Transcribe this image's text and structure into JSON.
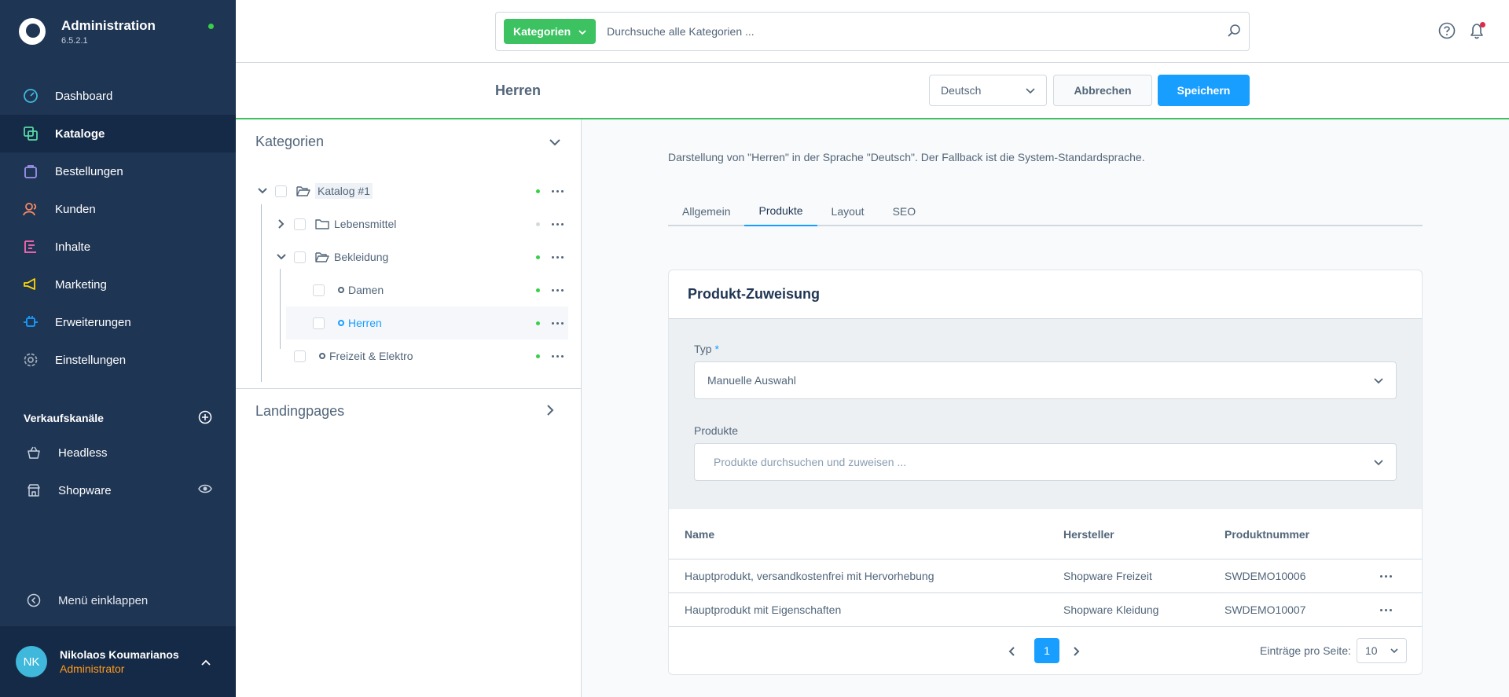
{
  "app": {
    "title": "Administration",
    "version": "6.5.2.1"
  },
  "nav": [
    {
      "label": "Dashboard",
      "icon": "dashboard-icon",
      "color": "#3fb8dc"
    },
    {
      "label": "Kataloge",
      "icon": "catalog-icon",
      "color": "#57d9a3"
    },
    {
      "label": "Bestellungen",
      "icon": "orders-icon",
      "color": "#a092f0"
    },
    {
      "label": "Kunden",
      "icon": "customers-icon",
      "color": "#f88962"
    },
    {
      "label": "Inhalte",
      "icon": "content-icon",
      "color": "#ff68b4"
    },
    {
      "label": "Marketing",
      "icon": "marketing-icon",
      "color": "#ffd700"
    },
    {
      "label": "Erweiterungen",
      "icon": "extensions-icon",
      "color": "#189eff"
    },
    {
      "label": "Einstellungen",
      "icon": "settings-icon",
      "color": "#9aa8b5"
    }
  ],
  "sales_channels": {
    "title": "Verkaufskanäle",
    "items": [
      {
        "label": "Headless"
      },
      {
        "label": "Shopware"
      }
    ]
  },
  "collapse_label": "Menü einklappen",
  "user": {
    "initials": "NK",
    "name": "Nikolaos Koumarianos",
    "role": "Administrator"
  },
  "search": {
    "type_label": "Kategorien",
    "placeholder": "Durchsuche alle Kategorien ..."
  },
  "smartbar": {
    "title": "Herren",
    "language": "Deutsch",
    "cancel_label": "Abbrechen",
    "save_label": "Speichern"
  },
  "tree": {
    "title": "Kategorien",
    "items": [
      {
        "label": "Katalog #1",
        "active": true
      },
      {
        "label": "Lebensmittel",
        "active": false
      },
      {
        "label": "Bekleidung",
        "active": true
      },
      {
        "label": "Damen",
        "active": true
      },
      {
        "label": "Herren",
        "active": true
      },
      {
        "label": "Freizeit & Elektro",
        "active": true
      }
    ],
    "landingpages_title": "Landingpages"
  },
  "content": {
    "lang_info": "Darstellung von \"Herren\" in der Sprache \"Deutsch\". Der Fallback ist die System-Standardsprache.",
    "tabs": [
      "Allgemein",
      "Produkte",
      "Layout",
      "SEO"
    ],
    "active_tab": "Produkte",
    "card": {
      "title": "Produkt-Zuweisung",
      "type_label": "Typ",
      "type_required": "*",
      "type_value": "Manuelle Auswahl",
      "products_label": "Produkte",
      "products_placeholder": "Produkte durchsuchen und zuweisen ...",
      "columns": [
        "Name",
        "Hersteller",
        "Produktnummer"
      ],
      "rows": [
        {
          "name": "Hauptprodukt, versandkostenfrei mit Hervorhebung",
          "manufacturer": "Shopware Freizeit",
          "number": "SWDEMO10006"
        },
        {
          "name": "Hauptprodukt mit Eigenschaften",
          "manufacturer": "Shopware Kleidung",
          "number": "SWDEMO10007"
        }
      ],
      "pagination": {
        "current_page": "1",
        "per_page_label": "Einträge pro Seite:",
        "per_page": "10"
      }
    }
  }
}
